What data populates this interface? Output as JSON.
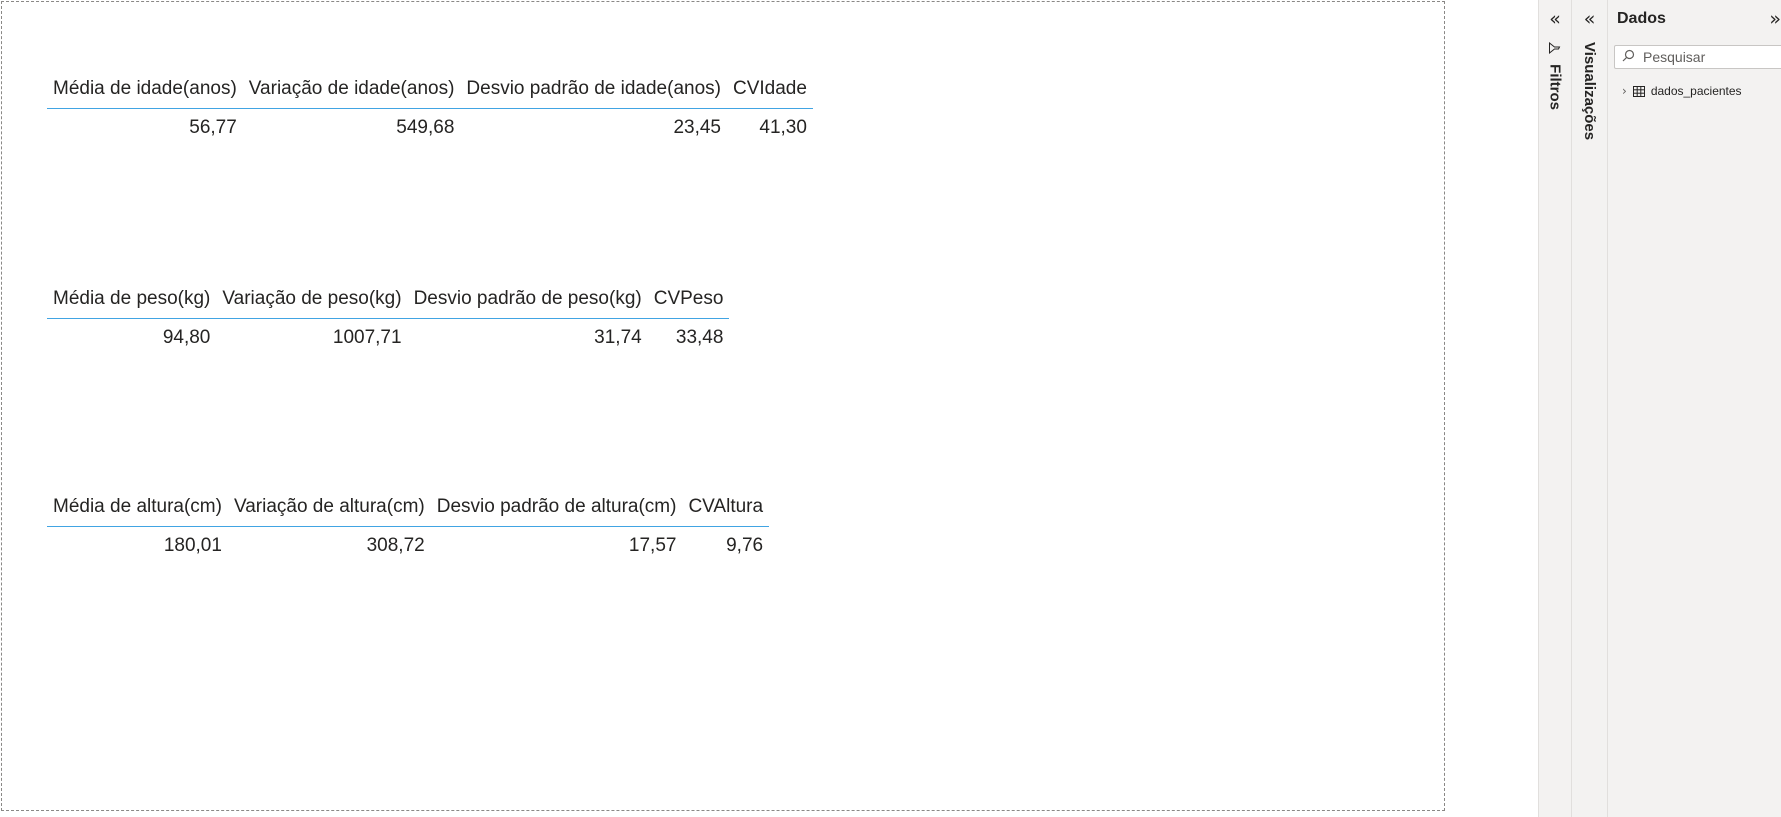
{
  "tables": [
    {
      "headers": [
        "Média de idade(anos)",
        "Variação de idade(anos)",
        "Desvio padrão de idade(anos)",
        "CVIdade"
      ],
      "values": [
        "56,77",
        "549,68",
        "23,45",
        "41,30"
      ]
    },
    {
      "headers": [
        "Média de peso(kg)",
        "Variação de peso(kg)",
        "Desvio padrão de peso(kg)",
        "CVPeso"
      ],
      "values": [
        "94,80",
        "1007,71",
        "31,74",
        "33,48"
      ]
    },
    {
      "headers": [
        "Média de altura(cm)",
        "Variação de altura(cm)",
        "Desvio padrão de altura(cm)",
        "CVAltura"
      ],
      "values": [
        "180,01",
        "308,72",
        "17,57",
        "9,76"
      ]
    }
  ],
  "panes": {
    "filters": {
      "label": "Filtros",
      "collapse_icon": "double-chevron-left-icon",
      "icon": "filter-icon"
    },
    "visualizations": {
      "label": "Visualizações",
      "collapse_icon": "double-chevron-left-icon"
    },
    "data": {
      "title": "Dados",
      "expand_icon": "double-chevron-right-icon",
      "search_placeholder": "Pesquisar",
      "items": [
        {
          "label": "dados_pacientes",
          "icon": "table-icon"
        }
      ]
    }
  },
  "colors": {
    "header_rule": "#41a4e3",
    "pane_bg": "#f3f2f1"
  }
}
